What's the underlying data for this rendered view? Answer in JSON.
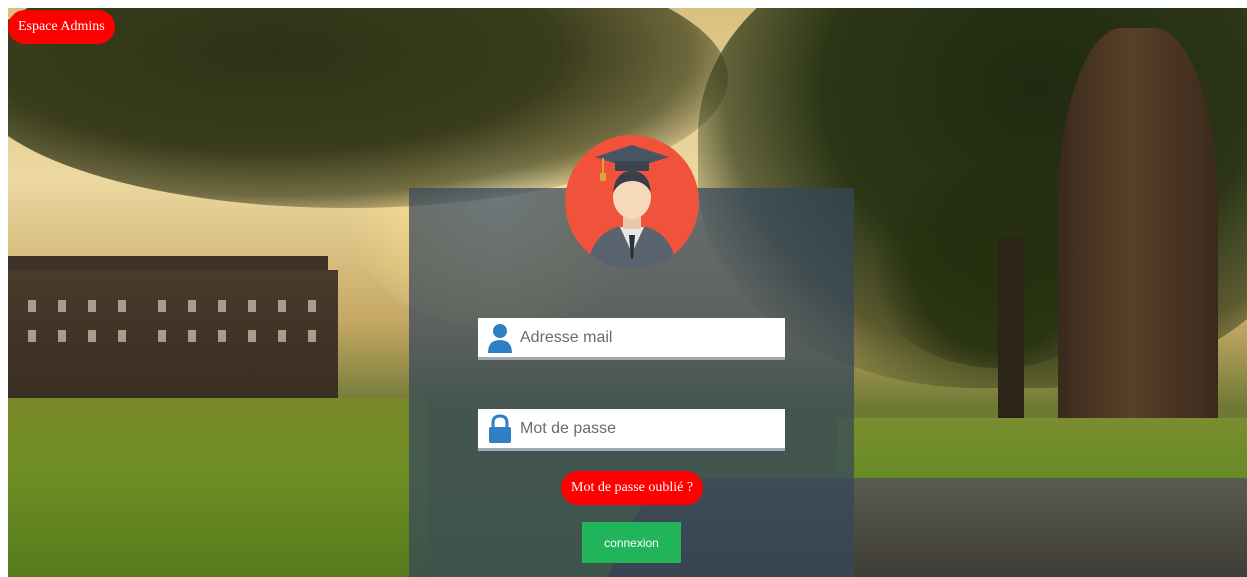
{
  "header": {
    "admin_button_label": "Espace Admins"
  },
  "login_form": {
    "avatar_icon": "graduate-student-icon",
    "email_placeholder": "Adresse mail",
    "email_icon": "user-icon",
    "password_placeholder": "Mot de passe",
    "password_icon": "lock-icon",
    "forgot_password_label": "Mot de passe oublié ?",
    "submit_label": "connexion"
  },
  "colors": {
    "admin_button": "#ff0000",
    "forgot_button": "#ff0000",
    "submit_button": "#22b45a",
    "avatar_background": "#f0523c",
    "icon_blue": "#2f7fc4",
    "panel_overlay": "rgba(52,70,92,0.72)"
  }
}
